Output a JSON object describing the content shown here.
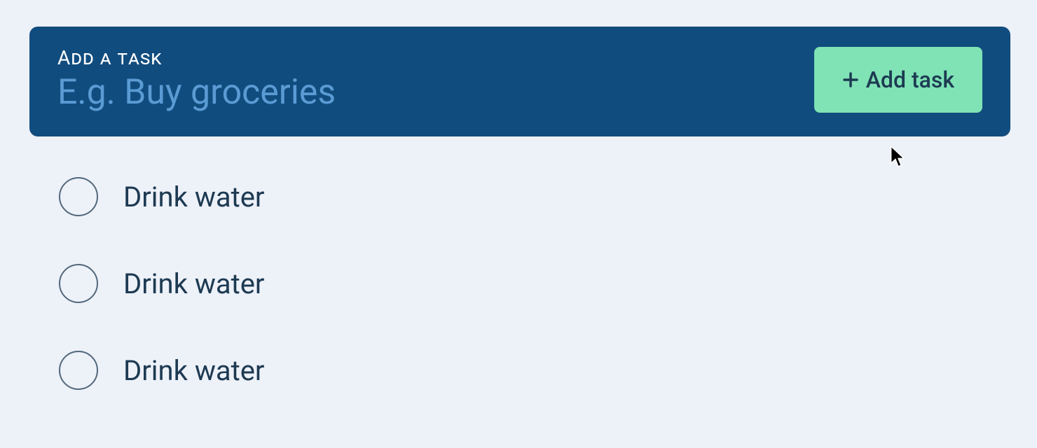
{
  "addTask": {
    "label": "Add a task",
    "placeholder": "E.g. Buy groceries",
    "value": "",
    "buttonLabel": "Add task"
  },
  "tasks": [
    {
      "label": "Drink water",
      "completed": false
    },
    {
      "label": "Drink water",
      "completed": false
    },
    {
      "label": "Drink water",
      "completed": false
    }
  ]
}
